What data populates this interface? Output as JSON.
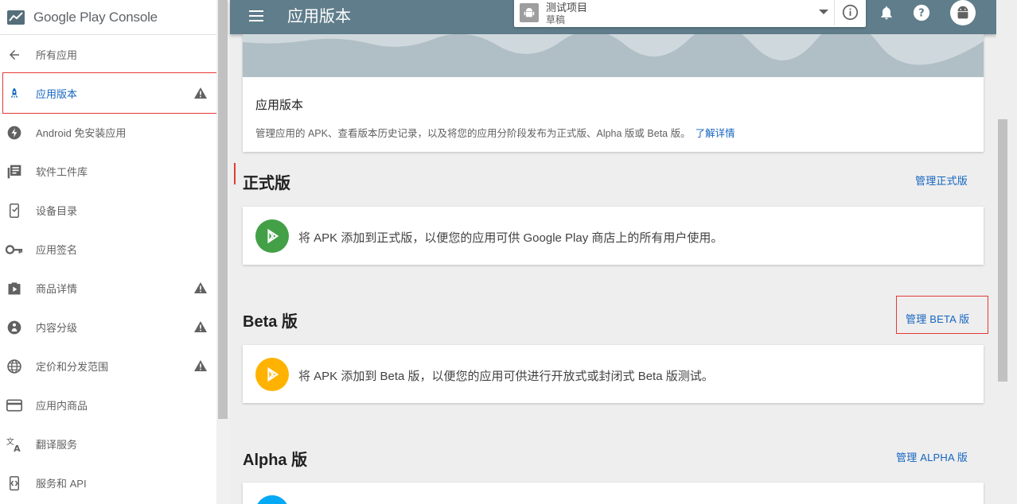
{
  "brand": {
    "name": "Google Play Console"
  },
  "sidebar": {
    "items": [
      {
        "label": "所有应用",
        "icon": "back-arrow-icon",
        "warning": false,
        "active": false
      },
      {
        "label": "应用版本",
        "icon": "rocket-icon",
        "warning": true,
        "active": true
      },
      {
        "label": "Android 免安装应用",
        "icon": "bolt-icon",
        "warning": false,
        "active": false
      },
      {
        "label": "软件工件库",
        "icon": "library-icon",
        "warning": false,
        "active": false
      },
      {
        "label": "设备目录",
        "icon": "device-icon",
        "warning": false,
        "active": false
      },
      {
        "label": "应用签名",
        "icon": "key-icon",
        "warning": false,
        "active": false
      },
      {
        "label": "商品详情",
        "icon": "store-icon",
        "warning": true,
        "active": false
      },
      {
        "label": "内容分级",
        "icon": "rating-icon",
        "warning": true,
        "active": false
      },
      {
        "label": "定价和分发范围",
        "icon": "globe-icon",
        "warning": true,
        "active": false
      },
      {
        "label": "应用内商品",
        "icon": "card-icon",
        "warning": false,
        "active": false
      },
      {
        "label": "翻译服务",
        "icon": "translate-icon",
        "warning": false,
        "active": false
      },
      {
        "label": "服务和 API",
        "icon": "api-icon",
        "warning": false,
        "active": false
      }
    ]
  },
  "topbar": {
    "title": "应用版本",
    "app_name": "测试项目",
    "app_state": "草稿"
  },
  "header": {
    "title": "应用版本",
    "description": "管理应用的 APK、查看版本历史记录，以及将您的应用分阶段发布为正式版、Alpha 版或 Beta 版。",
    "learn_more": "了解详情"
  },
  "tracks": {
    "production": {
      "title": "正式版",
      "manage": "管理正式版",
      "message": "将 APK 添加到正式版，以便您的应用可供 Google Play 商店上的所有用户使用。",
      "color": "#43a047"
    },
    "beta": {
      "title": "Beta 版",
      "manage": "管理 BETA 版",
      "message": "将 APK 添加到 Beta 版，以便您的应用可供进行开放式或封闭式 Beta 版测试。",
      "color": "#ffb300"
    },
    "alpha": {
      "title": "Alpha 版",
      "manage": "管理 ALPHA 版",
      "color": "#03a9f4"
    }
  }
}
